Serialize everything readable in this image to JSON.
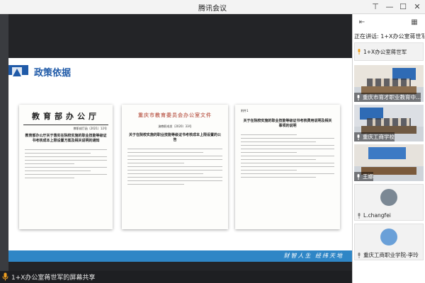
{
  "window": {
    "title": "腾讯会议"
  },
  "speaking": {
    "text": "正在讲话: 1+X办公室蒋世军"
  },
  "slide": {
    "title": "政策依据",
    "slogan": "财智人生  经纬天地",
    "doc1": {
      "header": "教育部办公厅",
      "number": "教职成厅函〔2021〕12号",
      "title": "教育部办公厅关于落实在院校实施的职业技能等级证书考核成本上限设置方案及相关说明的通知"
    },
    "doc2": {
      "header": "重庆市教育委员会办公室文件",
      "number": "渝教职成发〔2020〕33号",
      "title": "关于在院校实施的职业技能等级证书考核成本上限设置的公告"
    },
    "doc3": {
      "tag": "附件1",
      "title": "关于在院校实施的职业技能等级证书考核费用说明及相关事项的说明"
    }
  },
  "status": {
    "share_text": "1+X办公室蒋世军的屏幕共享"
  },
  "participants": [
    {
      "name": "1+X办公室蒋世军"
    },
    {
      "name": "重庆市育才职业教育中..."
    },
    {
      "name": "重庆工商学校"
    },
    {
      "name": "王娜"
    },
    {
      "name": "L.changfei"
    },
    {
      "name": "重庆工商职业学院-李玲"
    }
  ],
  "colors": {
    "accent": "#1f5aa8",
    "slide_bar": "#2f86c6",
    "mic_on": "#2fb45a"
  }
}
